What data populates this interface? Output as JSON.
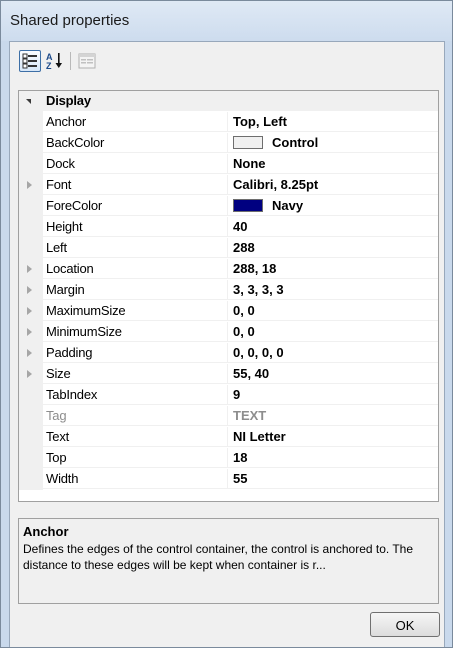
{
  "window": {
    "title": "Shared properties"
  },
  "toolbar": {
    "categorized_icon": "categorized-icon",
    "alphabetical_icon": "alphabetical-sort-icon",
    "property_pages_icon": "property-pages-icon"
  },
  "grid": {
    "category": "Display",
    "rows": [
      {
        "name": "Anchor",
        "value": "Top, Left"
      },
      {
        "name": "BackColor",
        "value": "Control",
        "swatch": "#f0f0f0"
      },
      {
        "name": "Dock",
        "value": "None"
      },
      {
        "name": "Font",
        "value": "Calibri, 8.25pt",
        "expandable": true
      },
      {
        "name": "ForeColor",
        "value": "Navy",
        "swatch": "#000080"
      },
      {
        "name": "Height",
        "value": "40"
      },
      {
        "name": "Left",
        "value": "288"
      },
      {
        "name": "Location",
        "value": "288, 18",
        "expandable": true
      },
      {
        "name": "Margin",
        "value": "3, 3, 3, 3",
        "expandable": true
      },
      {
        "name": "MaximumSize",
        "value": "0, 0",
        "expandable": true
      },
      {
        "name": "MinimumSize",
        "value": "0, 0",
        "expandable": true
      },
      {
        "name": "Padding",
        "value": "0, 0, 0, 0",
        "expandable": true
      },
      {
        "name": "Size",
        "value": "55, 40",
        "expandable": true
      },
      {
        "name": "TabIndex",
        "value": "9"
      },
      {
        "name": "Tag",
        "value": "TEXT",
        "grayed": true
      },
      {
        "name": "Text",
        "value": "NI Letter"
      },
      {
        "name": "Top",
        "value": "18"
      },
      {
        "name": "Width",
        "value": "55"
      }
    ]
  },
  "description": {
    "title": "Anchor",
    "text": "Defines the edges of the control container, the control is anchored to. The distance to these edges will be kept when container is r..."
  },
  "buttons": {
    "ok": "OK"
  }
}
